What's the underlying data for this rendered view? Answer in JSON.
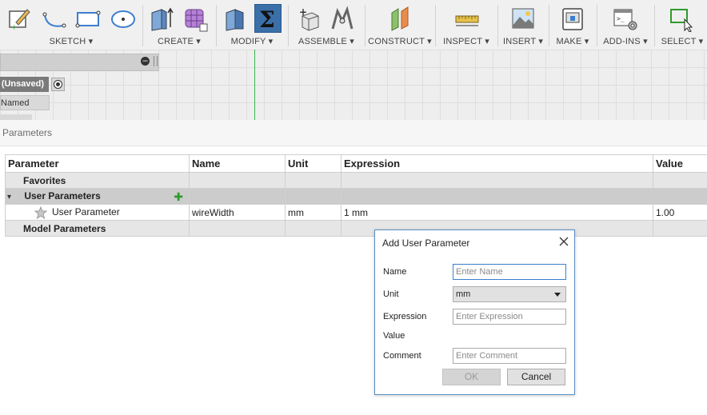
{
  "toolbar": {
    "groups": [
      {
        "label": "SKETCH ▾"
      },
      {
        "label": "CREATE ▾"
      },
      {
        "label": "MODIFY ▾"
      },
      {
        "label": "ASSEMBLE ▾"
      },
      {
        "label": "CONSTRUCT ▾"
      },
      {
        "label": "INSPECT ▾"
      },
      {
        "label": "INSERT ▾"
      },
      {
        "label": "MAKE ▾"
      },
      {
        "label": "ADD-INS ▾"
      },
      {
        "label": "SELECT ▾"
      }
    ]
  },
  "browser": {
    "document_state": "(Unsaved)",
    "named_views": "Named Views"
  },
  "panel": {
    "title": "Parameters"
  },
  "table": {
    "headers": [
      "Parameter",
      "Name",
      "Unit",
      "Expression",
      "Value"
    ],
    "favorites": "Favorites",
    "user_parameters": "User Parameters",
    "row": {
      "parameter": "User Parameter",
      "name": "wireWidth",
      "unit": "mm",
      "expression": "1 mm",
      "value": "1.00"
    },
    "model_parameters": "Model Parameters"
  },
  "dialog": {
    "title": "Add User Parameter",
    "labels": {
      "name": "Name",
      "unit": "Unit",
      "expression": "Expression",
      "value": "Value",
      "comment": "Comment"
    },
    "name_placeholder": "Enter Name",
    "unit_value": "mm",
    "expression_placeholder": "Enter Expression",
    "comment_placeholder": "Enter Comment",
    "ok_label": "OK",
    "cancel_label": "Cancel"
  },
  "colors": {
    "accent": "#3b6fa8",
    "dialog_border": "#5a8ec6",
    "add_green": "#2e9b2e",
    "origin_axis_green": "#39b54a"
  }
}
